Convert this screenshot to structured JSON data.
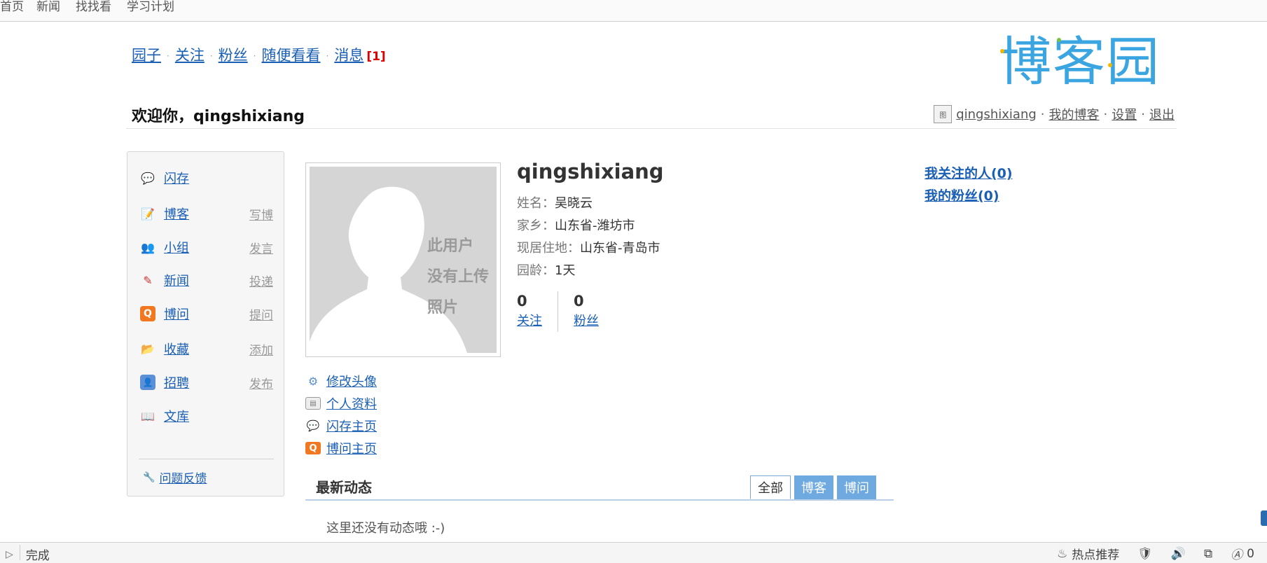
{
  "top_nav": [
    "首页",
    "新闻",
    "找找看",
    "学习计划"
  ],
  "site_links": [
    {
      "label": "园子"
    },
    {
      "label": "关注"
    },
    {
      "label": "粉丝"
    },
    {
      "label": "随便看看"
    },
    {
      "label": "消息",
      "badge": "[1]"
    }
  ],
  "logo": "博客园",
  "welcome": "欢迎你，qingshixiang",
  "user_bar": {
    "avatar_text": "图",
    "username": "qingshixiang",
    "my_blog": "我的博客",
    "settings": "设置",
    "logout": "退出",
    "separator": "·"
  },
  "sidebar": {
    "items": [
      {
        "label": "闪存",
        "action": "",
        "icon": "speech-bubble-icon"
      },
      {
        "label": "博客",
        "action": "写博",
        "icon": "blog-edit-icon"
      },
      {
        "label": "小组",
        "action": "发言",
        "icon": "group-icon"
      },
      {
        "label": "新闻",
        "action": "投递",
        "icon": "news-icon"
      },
      {
        "label": "博问",
        "action": "提问",
        "icon": "question-icon"
      },
      {
        "label": "收藏",
        "action": "添加",
        "icon": "folder-icon"
      },
      {
        "label": "招聘",
        "action": "发布",
        "icon": "person-card-icon"
      },
      {
        "label": "文库",
        "action": "",
        "icon": "book-icon"
      }
    ],
    "feedback": "问题反馈"
  },
  "profile": {
    "photo_note": [
      "此用户",
      "没有上传",
      "照片"
    ],
    "links": [
      {
        "label": "修改头像",
        "icon": "gear-icon"
      },
      {
        "label": "个人资料",
        "icon": "id-card-icon"
      },
      {
        "label": "闪存主页",
        "icon": "speech-bubble-icon"
      },
      {
        "label": "博问主页",
        "icon": "question-icon"
      }
    ],
    "name": "qingshixiang",
    "info": [
      {
        "key": "姓名：",
        "value": "吴晓云"
      },
      {
        "key": "家乡：",
        "value": "山东省-潍坊市"
      },
      {
        "key": "现居住地：",
        "value": "山东省-青岛市"
      },
      {
        "key": "园龄：",
        "value": "1天"
      }
    ],
    "stats": [
      {
        "num": "0",
        "label": "关注"
      },
      {
        "num": "0",
        "label": "粉丝"
      }
    ]
  },
  "right_links": [
    "我关注的人(0)",
    "我的粉丝(0)"
  ],
  "feed": {
    "title": "最新动态",
    "tabs": [
      {
        "label": "全部",
        "active": true
      },
      {
        "label": "博客",
        "active": false
      },
      {
        "label": "博问",
        "active": false
      }
    ],
    "empty_text": "这里还没有动态哦 :-)"
  },
  "status_bar": {
    "status": "完成",
    "hot": "热点推荐",
    "ad_count": "0"
  },
  "colors": {
    "link": "#1a5fb4",
    "badge": "#dd0000",
    "logo": "#3aa5e0",
    "tab_inactive": "#6ea9e0"
  }
}
